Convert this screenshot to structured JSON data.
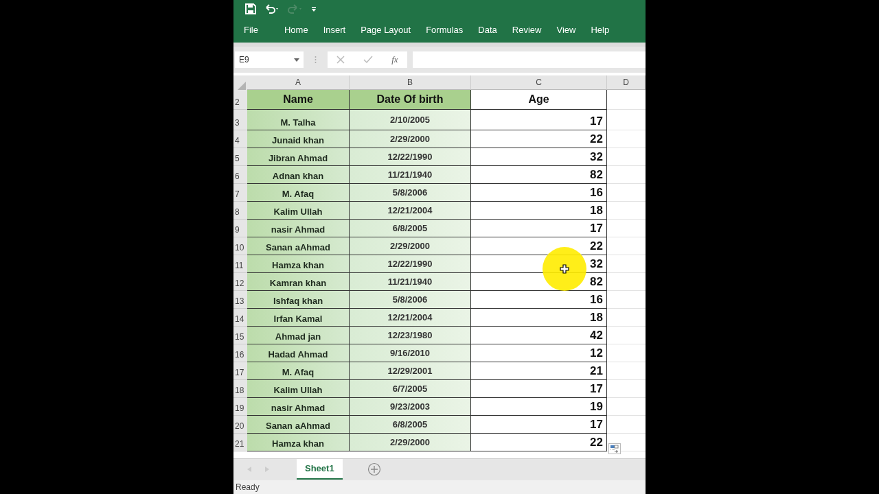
{
  "ribbon": {
    "tabs": [
      "File",
      "Home",
      "Insert",
      "Page Layout",
      "Formulas",
      "Data",
      "Review",
      "View",
      "Help"
    ]
  },
  "formula_bar": {
    "name_box": "E9",
    "function_label": "fx"
  },
  "sheet": {
    "columns": [
      "A",
      "B",
      "C",
      "D"
    ],
    "header": {
      "row": "2",
      "cells": [
        "Name",
        "Date Of birth",
        "Age"
      ]
    },
    "rows": [
      {
        "row": "3",
        "name": "M. Talha",
        "dob": "2/10/2005",
        "age": "17"
      },
      {
        "row": "4",
        "name": "Junaid khan",
        "dob": "2/29/2000",
        "age": "22"
      },
      {
        "row": "5",
        "name": "Jibran Ahmad",
        "dob": "12/22/1990",
        "age": "32"
      },
      {
        "row": "6",
        "name": "Adnan khan",
        "dob": "11/21/1940",
        "age": "82"
      },
      {
        "row": "7",
        "name": "M. Afaq",
        "dob": "5/8/2006",
        "age": "16"
      },
      {
        "row": "8",
        "name": "Kalim Ullah",
        "dob": "12/21/2004",
        "age": "18"
      },
      {
        "row": "9",
        "name": "nasir Ahmad",
        "dob": "6/8/2005",
        "age": "17"
      },
      {
        "row": "10",
        "name": "Sanan aAhmad",
        "dob": "2/29/2000",
        "age": "22"
      },
      {
        "row": "11",
        "name": "Hamza khan",
        "dob": "12/22/1990",
        "age": "32"
      },
      {
        "row": "12",
        "name": "Kamran khan",
        "dob": "11/21/1940",
        "age": "82"
      },
      {
        "row": "13",
        "name": "Ishfaq khan",
        "dob": "5/8/2006",
        "age": "16"
      },
      {
        "row": "14",
        "name": "Irfan Kamal",
        "dob": "12/21/2004",
        "age": "18"
      },
      {
        "row": "15",
        "name": "Ahmad jan",
        "dob": "12/23/1980",
        "age": "42"
      },
      {
        "row": "16",
        "name": "Hadad Ahmad",
        "dob": "9/16/2010",
        "age": "12"
      },
      {
        "row": "17",
        "name": "M. Afaq",
        "dob": "12/29/2001",
        "age": "21"
      },
      {
        "row": "18",
        "name": "Kalim Ullah",
        "dob": "6/7/2005",
        "age": "17"
      },
      {
        "row": "19",
        "name": "nasir Ahmad",
        "dob": "9/23/2003",
        "age": "19"
      },
      {
        "row": "20",
        "name": "Sanan aAhmad",
        "dob": "6/8/2005",
        "age": "17"
      },
      {
        "row": "21",
        "name": "Hamza khan",
        "dob": "2/29/2000",
        "age": "22"
      }
    ]
  },
  "sheet_tabs": [
    {
      "label": "Sheet1",
      "selected": true
    }
  ],
  "status_bar": {
    "text": "Ready"
  }
}
